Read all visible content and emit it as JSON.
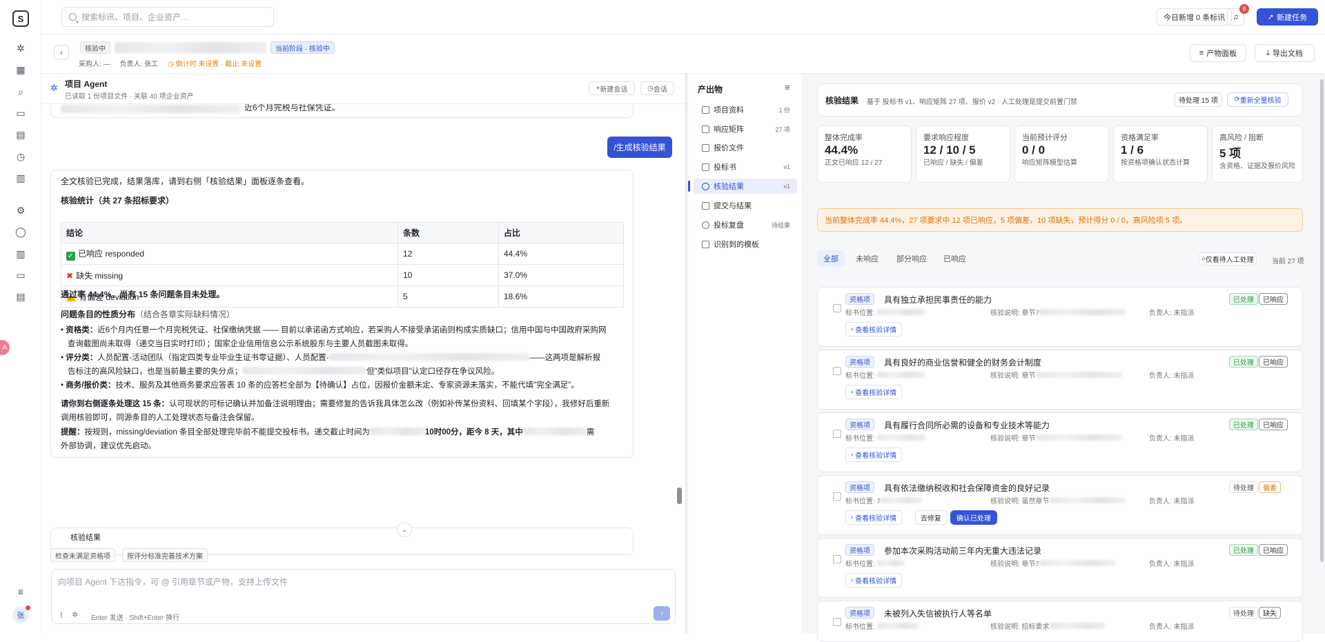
{
  "topbar": {
    "search_placeholder": "搜索标讯、项目、企业资产...",
    "today_new": "今日新增 0 条标讯",
    "notifications": "8",
    "new_task": "新建任务"
  },
  "project": {
    "status_tag": "核验中",
    "stage_tag": "当前阶段 · 核验中",
    "purchaser": "采购人: —",
    "owner": "负责人: 张工",
    "countdown": "倒计时 未设置 · 截止 未设置",
    "artifact_board": "产物面板",
    "export_doc": "导出文档"
  },
  "agent": {
    "title": "项目 Agent",
    "subtitle": "已读取 1 份项目文件 · 关联 40 项企业资产",
    "new_session": "新建会话",
    "sessions": "会话"
  },
  "chat": {
    "prev_tail": "近6个月完税与社保凭证。",
    "user_cmd": "/生成核验结果",
    "intro": "全文核验已完成，结果落库，请到右侧「核验结果」面板逐条查看。",
    "stats_title": "核验统计（共 27 条招标要求）",
    "table_headers": [
      "结论",
      "条数",
      "占比"
    ],
    "table_rows": [
      {
        "label": "已响应 responded",
        "count": "12",
        "pct": "44.4%"
      },
      {
        "label": "缺失 missing",
        "count": "10",
        "pct": "37.0%"
      },
      {
        "label": "有偏差 deviation",
        "count": "5",
        "pct": "18.6%"
      }
    ],
    "pass_rate": "通过率 44.4%，尚有 15 条问题条目未处理。",
    "dist_title": "问题条目的性质分布",
    "dist_sub": "（结合各章实际缺料情况）",
    "b1_head": "资格类：",
    "b1_line1": "近6个月内任意一个月完税凭证、社保缴纳凭据 —— 目前以承诺函方式响应，若采购人不接受承诺函则构成实质缺口；信用中国与中国政府采购网",
    "b1_line2": "查询截图尚未取得（递交当日实时打印）；国家企业信用信息公示系统股东与主要人员截图未取得。",
    "b2_head": "评分类：",
    "b2_line1a": "人员配置-活动团队（指定四类专业毕业生证书零证据）、人员配置-",
    "b2_line1b": "——这两项是解析报",
    "b2_line2a": "告标注的高风险缺口，也是当前最主要的失分点；",
    "b2_line2b": "但\"类似项目\"认定口径存在争议风险。",
    "b3_head": "商务/报价类：",
    "b3_line": "技术、服务及其他商务要求应答表 10 条的应答栏全部为【待确认】占位，因报价金额未定、专家资源未落实，不能代填\"完全满足\"。",
    "p1_head": "请你到右侧逐条处理这 15 条：",
    "p1_line1": "认可现状的可标记确认并加备注说明理由；需要修复的告诉我具体怎么改（例如补传某份资料、回填某个字段），我修好后重新",
    "p1_line2": "调用核验即可，同源条目的人工处理状态与备注会保留。",
    "p2_head": "提醒：",
    "p2_line1a": "按规则，missing/deviation 条目全部处理完毕前不能提交投标书。递交截止时间为",
    "p2_line1b": "10时00分，距今 8 天，其中",
    "p2_line1c": "需",
    "p2_line2": "外部协调，建议优先启动。",
    "next_card_title": "核验结果"
  },
  "suggestions": [
    "检查未满足资格项",
    "按评分标准完善技术方案"
  ],
  "composer": {
    "placeholder": "向项目 Agent 下达指令，可 @ 引用章节或产物，支持上传文件",
    "hint": "Enter 发送 · Shift+Enter 换行"
  },
  "artifacts": {
    "title": "产出物",
    "items": [
      {
        "label": "项目资料",
        "count": "1 份"
      },
      {
        "label": "响应矩阵",
        "count": "27 项"
      },
      {
        "label": "报价文件",
        "count": ""
      },
      {
        "label": "投标书",
        "count": "v1"
      },
      {
        "label": "核验结果",
        "count": "v1"
      },
      {
        "label": "提交与结果",
        "count": ""
      },
      {
        "label": "投标复盘",
        "count": "待结果"
      },
      {
        "label": "识别到的模板",
        "count": ""
      }
    ]
  },
  "results": {
    "title": "核验结果",
    "subtitle": "基于 投标书 v1、响应矩阵 27 项、报价 v2 · 人工处理是提交前置门禁",
    "pending": "待处理 15 项",
    "rerun": "重新全量核验",
    "stats": [
      {
        "label": "整体完成率",
        "value": "44.4%",
        "sub": "正文已响应 12 / 27"
      },
      {
        "label": "要求响应程度",
        "value": "12 / 10 / 5",
        "sub": "已响应 / 缺失 / 偏差"
      },
      {
        "label": "当前预计评分",
        "value": "0 / 0",
        "sub": "响应矩阵模型估算"
      },
      {
        "label": "资格满足率",
        "value": "1 / 6",
        "sub": "按资格项确认状态计算"
      },
      {
        "label": "高风险 / 阻断",
        "value": "5 项",
        "sub": "含资格、证据及报价风险"
      }
    ],
    "alert": "当前整体完成率 44.4%，27 项要求中 12 项已响应，5 项偏差，10 项缺失，预计得分 0 / 0，高风险项 5 项。",
    "tabs": [
      "全部",
      "未响应",
      "部分响应",
      "已响应"
    ],
    "only_pending": "仅看待人工处理",
    "count_label": "当前 27 项",
    "detail_label": "查看核验详情",
    "fix_label": "去修复",
    "confirm_label": "确认已处理",
    "loc_label": "标书位置:",
    "owner_label": "负责人: 未指派",
    "items": [
      {
        "type": "资格项",
        "title": "具有独立承担民事责任的能力",
        "note": "核验说明: 章节7",
        "s1": "已处理",
        "s2": "已响应"
      },
      {
        "type": "资格项",
        "title": "具有良好的商业信誉和健全的财务会计制度",
        "note": "核验说明: 章节",
        "s1": "已处理",
        "s2": "已响应"
      },
      {
        "type": "资格项",
        "title": "具有履行合同所必需的设备和专业技术等能力",
        "note": "核验说明: 章节",
        "s1": "已处理",
        "s2": "已响应"
      },
      {
        "type": "资格项",
        "title": "具有依法缴纳税收和社会保障资金的良好记录",
        "note": "核验说明: 虽然章节",
        "s1": "待处理",
        "s2": "偏差"
      },
      {
        "type": "资格项",
        "title": "参加本次采购活动前三年内无重大违法记录",
        "note": "核验说明: 章节7",
        "s1": "已处理",
        "s2": "已响应"
      },
      {
        "type": "资格项",
        "title": "未被列入失信被执行人等名单",
        "note": "核验说明: 招标要求",
        "s1": "待处理",
        "s2": "缺失"
      }
    ]
  }
}
